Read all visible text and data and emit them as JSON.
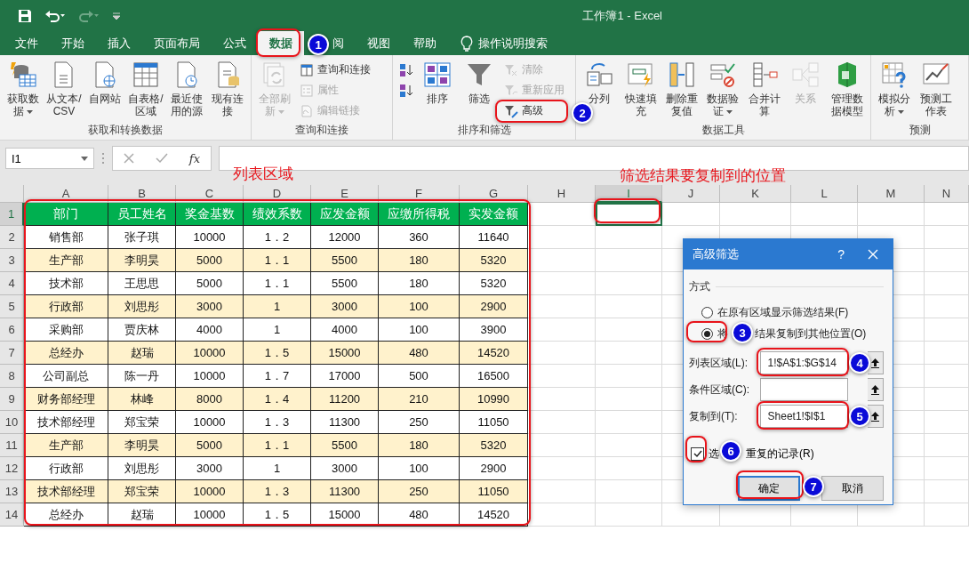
{
  "window": {
    "title": "工作簿1  -  Excel"
  },
  "tabs": [
    {
      "label": "文件",
      "selected": false
    },
    {
      "label": "开始",
      "selected": false
    },
    {
      "label": "插入",
      "selected": false
    },
    {
      "label": "页面布局",
      "selected": false
    },
    {
      "label": "公式",
      "selected": false
    },
    {
      "label": "数据",
      "selected": true
    },
    {
      "label": "阅",
      "selected": false
    },
    {
      "label": "视图",
      "selected": false
    },
    {
      "label": "帮助",
      "selected": false
    }
  ],
  "search": {
    "label": "操作说明搜索"
  },
  "ribbon": {
    "groups": [
      {
        "label": "获取和转换数据",
        "commands": [
          {
            "kind": "large",
            "label": "获取数据",
            "dropdown": true,
            "disabled": false
          },
          {
            "kind": "large",
            "label": "从文本/CSV",
            "dropdown": false,
            "disabled": false
          },
          {
            "kind": "large",
            "label": "自网站",
            "dropdown": false,
            "disabled": false
          },
          {
            "kind": "large",
            "label": "自表格/区域",
            "dropdown": false,
            "disabled": false
          },
          {
            "kind": "large",
            "label": "最近使用的源",
            "dropdown": false,
            "disabled": false
          },
          {
            "kind": "large",
            "label": "现有连接",
            "dropdown": false,
            "disabled": false
          }
        ]
      },
      {
        "label": "查询和连接",
        "commands": [
          {
            "kind": "large",
            "label": "全部刷新",
            "dropdown": true,
            "disabled": true
          },
          {
            "kind": "small",
            "label": "查询和连接",
            "disabled": false
          },
          {
            "kind": "small",
            "label": "属性",
            "disabled": true
          },
          {
            "kind": "small",
            "label": "编辑链接",
            "disabled": true
          }
        ]
      },
      {
        "label": "排序和筛选",
        "commands": [
          {
            "kind": "small",
            "disabled": false
          },
          {
            "kind": "small",
            "disabled": false
          },
          {
            "kind": "large",
            "label": "排序",
            "dropdown": false,
            "disabled": false
          },
          {
            "kind": "large",
            "label": "筛选",
            "dropdown": false,
            "disabled": false
          },
          {
            "kind": "small",
            "label": "清除",
            "disabled": true
          },
          {
            "kind": "small",
            "label": "重新应用",
            "disabled": true
          },
          {
            "kind": "small",
            "label": "高级",
            "disabled": false
          }
        ]
      },
      {
        "label": "数据工具",
        "commands": [
          {
            "kind": "large",
            "label": "分列",
            "dropdown": false,
            "disabled": false
          },
          {
            "kind": "large",
            "label": "快速填充",
            "dropdown": false,
            "disabled": false
          },
          {
            "kind": "large",
            "label": "删除重复值",
            "dropdown": false,
            "disabled": false
          },
          {
            "kind": "large",
            "label": "数据验证",
            "dropdown": true,
            "disabled": false
          },
          {
            "kind": "large",
            "label": "合并计算",
            "dropdown": false,
            "disabled": false
          },
          {
            "kind": "large",
            "label": "关系",
            "dropdown": false,
            "disabled": true
          },
          {
            "kind": "large",
            "label": "管理数据模型",
            "dropdown": false,
            "disabled": false
          }
        ]
      },
      {
        "label": "预测",
        "commands": [
          {
            "kind": "large",
            "label": "模拟分析",
            "dropdown": true,
            "disabled": false
          },
          {
            "kind": "large",
            "label": "预测工作表",
            "dropdown": false,
            "disabled": false
          }
        ]
      }
    ]
  },
  "formula_bar": {
    "name_box": "I1",
    "function_label": "fx"
  },
  "sheet": {
    "columns": [
      {
        "label": "A",
        "selected": false
      },
      {
        "label": "B",
        "selected": false
      },
      {
        "label": "C",
        "selected": false
      },
      {
        "label": "D",
        "selected": false
      },
      {
        "label": "E",
        "selected": false
      },
      {
        "label": "F",
        "selected": false
      },
      {
        "label": "G",
        "selected": false
      },
      {
        "label": "H",
        "selected": false
      },
      {
        "label": "I",
        "selected": true
      },
      {
        "label": "J",
        "selected": false
      },
      {
        "label": "K",
        "selected": false
      },
      {
        "label": "L",
        "selected": false
      },
      {
        "label": "M",
        "selected": false
      },
      {
        "label": "N",
        "selected": false
      }
    ],
    "row_numbers": [
      {
        "label": "1",
        "selected": true
      },
      {
        "label": "2",
        "selected": false
      },
      {
        "label": "3",
        "selected": false
      },
      {
        "label": "4",
        "selected": false
      },
      {
        "label": "5",
        "selected": false
      },
      {
        "label": "6",
        "selected": false
      },
      {
        "label": "7",
        "selected": false
      },
      {
        "label": "8",
        "selected": false
      },
      {
        "label": "9",
        "selected": false
      },
      {
        "label": "10",
        "selected": false
      },
      {
        "label": "11",
        "selected": false
      },
      {
        "label": "12",
        "selected": false
      },
      {
        "label": "13",
        "selected": false
      },
      {
        "label": "14",
        "selected": false
      }
    ]
  },
  "table": {
    "headers": [
      "部门",
      "员工姓名",
      "奖金基数",
      "绩效系数",
      "应发金额",
      "应缴所得税",
      "实发金额"
    ],
    "rows": [
      {
        "shaded": false,
        "cells": [
          "销售部",
          "张子琪",
          "10000",
          "1．2",
          "12000",
          "360",
          "11640"
        ]
      },
      {
        "shaded": true,
        "cells": [
          "生产部",
          "李明昊",
          "5000",
          "1．1",
          "5500",
          "180",
          "5320"
        ]
      },
      {
        "shaded": false,
        "cells": [
          "技术部",
          "王思思",
          "5000",
          "1．1",
          "5500",
          "180",
          "5320"
        ]
      },
      {
        "shaded": true,
        "cells": [
          "行政部",
          "刘思彤",
          "3000",
          "1",
          "3000",
          "100",
          "2900"
        ]
      },
      {
        "shaded": false,
        "cells": [
          "采购部",
          "贾庆林",
          "4000",
          "1",
          "4000",
          "100",
          "3900"
        ]
      },
      {
        "shaded": true,
        "cells": [
          "总经办",
          "赵瑞",
          "10000",
          "1．5",
          "15000",
          "480",
          "14520"
        ]
      },
      {
        "shaded": false,
        "cells": [
          "公司副总",
          "陈一丹",
          "10000",
          "1．7",
          "17000",
          "500",
          "16500"
        ]
      },
      {
        "shaded": true,
        "cells": [
          "财务部经理",
          "林峰",
          "8000",
          "1．4",
          "11200",
          "210",
          "10990"
        ]
      },
      {
        "shaded": false,
        "cells": [
          "技术部经理",
          "郑宝荣",
          "10000",
          "1．3",
          "11300",
          "250",
          "11050"
        ]
      },
      {
        "shaded": true,
        "cells": [
          "生产部",
          "李明昊",
          "5000",
          "1．1",
          "5500",
          "180",
          "5320"
        ]
      },
      {
        "shaded": false,
        "cells": [
          "行政部",
          "刘思彤",
          "3000",
          "1",
          "3000",
          "100",
          "2900"
        ]
      },
      {
        "shaded": true,
        "cells": [
          "技术部经理",
          "郑宝荣",
          "10000",
          "1．3",
          "11300",
          "250",
          "11050"
        ]
      },
      {
        "shaded": false,
        "cells": [
          "总经办",
          "赵瑞",
          "10000",
          "1．5",
          "15000",
          "480",
          "14520"
        ]
      }
    ]
  },
  "dialog": {
    "title": "高级筛选",
    "help": "?",
    "section": "方式",
    "options": [
      {
        "label_parts": [
          "在原有区域显示筛选结果(F)"
        ],
        "selected": false
      },
      {
        "label_parts": [
          "将",
          "结果复制到其他位置(O)"
        ],
        "selected": true
      }
    ],
    "fields": [
      {
        "label": "列表区域(L):",
        "value": "1!$A$1:$G$14"
      },
      {
        "label": "条件区域(C):"
      },
      {
        "label": "复制到(T):",
        "value": "Sheet1!$I$1"
      }
    ],
    "checkbox": {
      "label_parts": [
        "选",
        "重复的记录(R)"
      ],
      "checked": true
    },
    "buttons": [
      {
        "label": "确定",
        "default": true
      },
      {
        "label": "取消",
        "default": false
      }
    ]
  },
  "callouts": [
    "列表区域",
    "筛选结果要复制到的位置"
  ],
  "badges": [
    "1",
    "2",
    "3",
    "4",
    "5",
    "6",
    "7"
  ]
}
